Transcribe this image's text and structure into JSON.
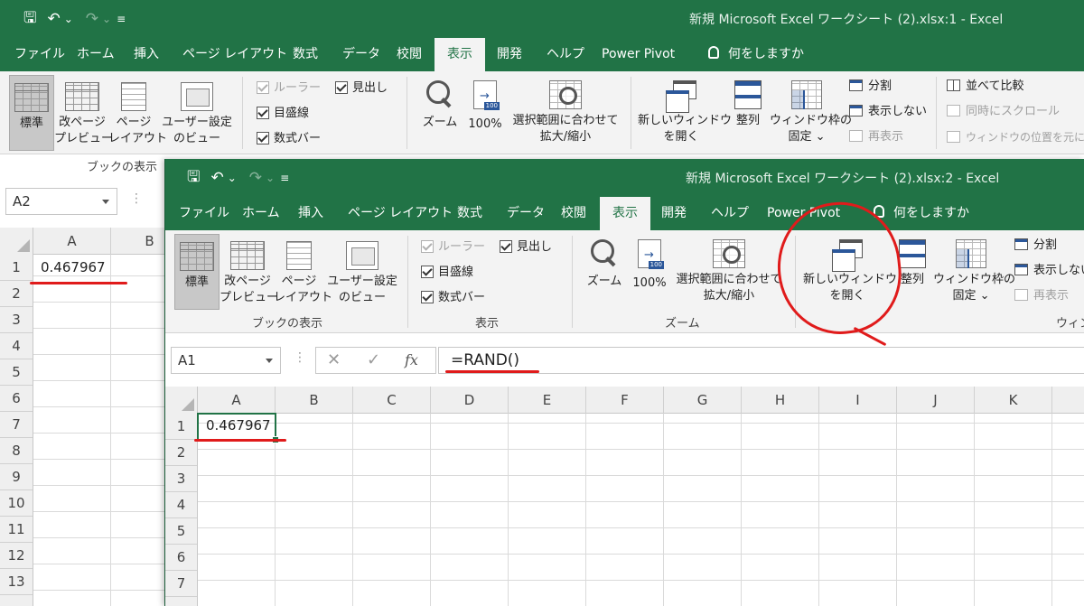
{
  "back_window": {
    "title": "新規 Microsoft Excel ワークシート (2).xlsx:1  -  Excel",
    "tabs": [
      "ファイル",
      "ホーム",
      "挿入",
      "ページ レイアウト",
      "数式",
      "データ",
      "校閲",
      "表示",
      "開発",
      "ヘルプ",
      "Power Pivot"
    ],
    "active_tab": "表示",
    "tell_me": "何をしますか",
    "ribbon": {
      "normal": "標準",
      "page_break_1": "改ページ",
      "page_break_2": "プレビュー",
      "page_layout_1": "ページ",
      "page_layout_2": "レイアウト",
      "custom_view_1": "ユーザー設定",
      "custom_view_2": "のビュー",
      "group_workbook_views": "ブックの表示",
      "ruler": "ルーラー",
      "gridlines": "目盛線",
      "formula_bar": "数式バー",
      "headings": "見出し",
      "zoom": "ズーム",
      "zoom100": "100%",
      "zoom_sel_1": "選択範囲に合わせて",
      "zoom_sel_2": "拡大/縮小",
      "new_window_1": "新しいウィンドウ",
      "new_window_2": "を開く",
      "arrange": "整列",
      "freeze_1": "ウィンドウ枠の",
      "freeze_2": "固定 ⌄",
      "split": "分割",
      "hide": "表示しない",
      "unhide": "再表示",
      "side_by_side": "並べて比較",
      "sync_scroll": "同時にスクロール",
      "reset_pos": "ウィンドウの位置を元に"
    },
    "name_box": "A2",
    "columns": [
      "A",
      "B"
    ],
    "rows": [
      "1",
      "2",
      "3",
      "4",
      "5",
      "6",
      "7",
      "8",
      "9",
      "10",
      "11",
      "12",
      "13"
    ],
    "cell_a1": "0.467967"
  },
  "front_window": {
    "title": "新規 Microsoft Excel ワークシート (2).xlsx:2  -  Excel",
    "tabs": [
      "ファイル",
      "ホーム",
      "挿入",
      "ページ レイアウト",
      "数式",
      "データ",
      "校閲",
      "表示",
      "開発",
      "ヘルプ",
      "Power Pivot"
    ],
    "active_tab": "表示",
    "tell_me": "何をしますか",
    "ribbon": {
      "normal": "標準",
      "page_break_1": "改ページ",
      "page_break_2": "プレビュー",
      "page_layout_1": "ページ",
      "page_layout_2": "レイアウト",
      "custom_view_1": "ユーザー設定",
      "custom_view_2": "のビュー",
      "group_workbook_views": "ブックの表示",
      "ruler": "ルーラー",
      "gridlines": "目盛線",
      "formula_bar": "数式バー",
      "headings": "見出し",
      "group_show": "表示",
      "zoom": "ズーム",
      "zoom100": "100%",
      "zoom_sel_1": "選択範囲に合わせて",
      "zoom_sel_2": "拡大/縮小",
      "group_zoom": "ズーム",
      "new_window_1": "新しいウィンドウ",
      "new_window_2": "を開く",
      "arrange": "整列",
      "freeze_1": "ウィンドウ枠の",
      "freeze_2": "固定 ⌄",
      "split": "分割",
      "hide": "表示しない",
      "unhide": "再表示",
      "group_window_partial": "ウィン"
    },
    "name_box": "A1",
    "fx": "fx",
    "formula": "=RAND()",
    "columns": [
      "A",
      "B",
      "C",
      "D",
      "E",
      "F",
      "G",
      "H",
      "I",
      "J",
      "K"
    ],
    "rows": [
      "1",
      "2",
      "3",
      "4",
      "5",
      "6",
      "7"
    ],
    "cell_a1": "0.467967"
  },
  "colors": {
    "excel_green": "#217346",
    "ribbon_bg": "#f3f3f3",
    "annotation_red": "#e01b1b"
  }
}
